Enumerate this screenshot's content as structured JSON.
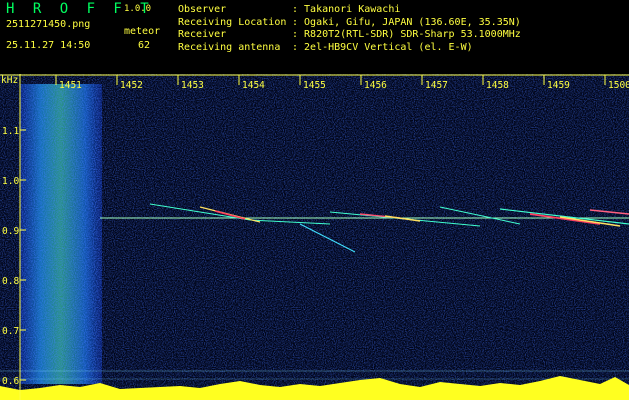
{
  "app": {
    "title": "H R O F F T",
    "version": "1.0.0"
  },
  "file": {
    "name": "2511271450.png",
    "datetime": "25.11.27 14:50"
  },
  "meteor": {
    "label": "meteor",
    "count": "62"
  },
  "info": [
    {
      "key": "Observer",
      "value": ": Takanori Kawachi"
    },
    {
      "key": "Receiving Location",
      "value": ": Ogaki, Gifu, JAPAN (136.60E, 35.35N)"
    },
    {
      "key": "Receiver",
      "value": ": R820T2(RTL-SDR) SDR-Sharp 53.1000MHz"
    },
    {
      "key": "Receiving antenna",
      "value": ": 2el-HB9CV Vertical (el. E-W)"
    }
  ],
  "axis": {
    "unit": "kHz",
    "time_ticks": [
      "1451",
      "1452",
      "1453",
      "1454",
      "1455",
      "1456",
      "1457",
      "1458",
      "1459",
      "1500"
    ],
    "freq_ticks": [
      "1.1",
      "1.0",
      "0.9",
      "0.8",
      "0.7",
      "0.6"
    ]
  },
  "colors": {
    "text": "#ffff40",
    "title": "#00ff60",
    "background": "#000000",
    "noise": "#0a1ea0"
  }
}
